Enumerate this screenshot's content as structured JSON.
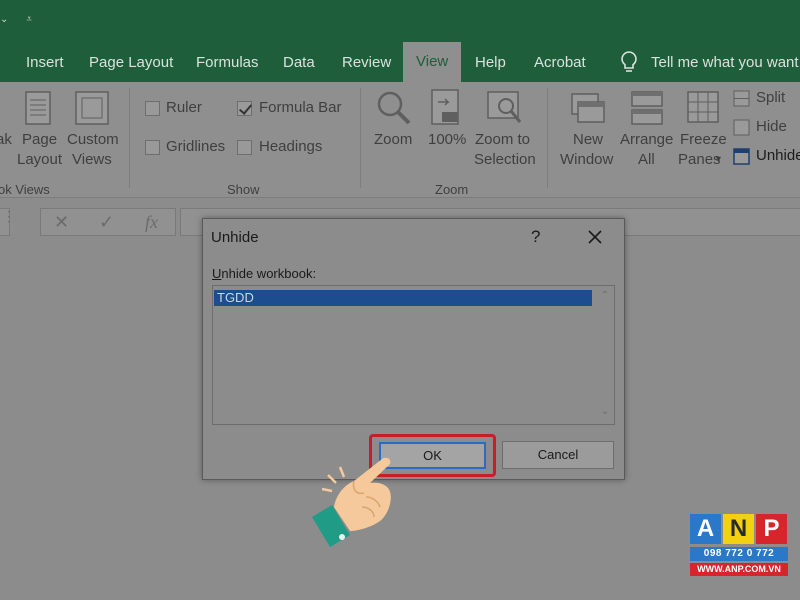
{
  "tabs": [
    {
      "label": "Insert"
    },
    {
      "label": "Page Layout"
    },
    {
      "label": "Formulas"
    },
    {
      "label": "Data"
    },
    {
      "label": "Review"
    },
    {
      "label": "View"
    },
    {
      "label": "Help"
    },
    {
      "label": "Acrobat"
    }
  ],
  "tell_me": "Tell me what you want",
  "ribbon": {
    "workbook_views": {
      "partial_label_line1": "ak",
      "page_layout_line1": "Page",
      "page_layout_line2": "Layout",
      "custom_views_line1": "Custom",
      "custom_views_line2": "Views",
      "group_label": "ok Views"
    },
    "show": {
      "ruler": "Ruler",
      "formula_bar": "Formula Bar",
      "gridlines": "Gridlines",
      "headings": "Headings",
      "group_label": "Show"
    },
    "zoom": {
      "zoom": "Zoom",
      "hundred": "100%",
      "zoom_to_line1": "Zoom to",
      "zoom_to_line2": "Selection",
      "group_label": "Zoom"
    },
    "window": {
      "new_window_line1": "New",
      "new_window_line2": "Window",
      "arrange_line1": "Arrange",
      "arrange_line2": "All",
      "freeze_line1": "Freeze",
      "freeze_line2": "Panes",
      "split": "Split",
      "hide": "Hide",
      "unhide": "Unhide"
    }
  },
  "formula_bar": {
    "cancel": "✕",
    "enter": "✓",
    "fx": "fx"
  },
  "dialog": {
    "title": "Unhide",
    "help": "?",
    "label_prefix": "U",
    "label_rest": "nhide workbook:",
    "items": [
      "TGDD"
    ],
    "ok": "OK",
    "cancel": "Cancel"
  },
  "logo": {
    "a": "A",
    "n": "N",
    "p": "P",
    "phone": "098 772 0 772",
    "url": "WWW.ANP.COM.VN"
  },
  "colors": {
    "title_green": "#1e5e3b",
    "ok_highlight": "#c41f2a",
    "selection_blue": "#1c4d8c"
  }
}
